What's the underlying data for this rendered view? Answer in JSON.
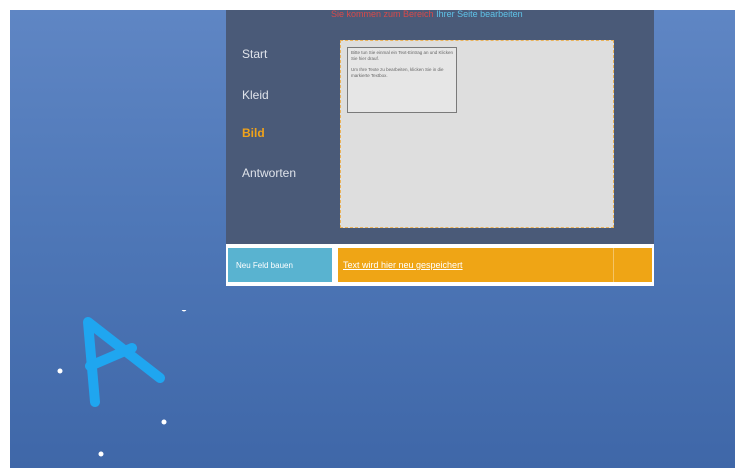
{
  "header": {
    "title_part1": "Sie kommen zum Bereich",
    "title_part2": "Ihrer Seite bearbeiten"
  },
  "sidebar": {
    "items": [
      {
        "label": "Start"
      },
      {
        "label": "Kleid"
      },
      {
        "label": "Bild",
        "active": true
      },
      {
        "label": "Antworten"
      }
    ]
  },
  "canvas": {
    "text_paragraph_1": "Bitte tun Sie einmal ein Text-Eintrag an und Klicken Sie hier drauf.",
    "text_paragraph_2": "Um Ihre Texte zu bearbeiten, klicken Sie in die markierte Textbox."
  },
  "actions": {
    "new_field_label": "Neu Feld bauen",
    "save_label": "Text wird hier neu gespeichert"
  },
  "colors": {
    "background": "#4f78b8",
    "panel": "#4a5a78",
    "accent_orange": "#efa515",
    "accent_blue": "#59b3d0",
    "logo_blue": "#1fa6f0"
  },
  "logo": {
    "icon": "letter-a-logo"
  }
}
